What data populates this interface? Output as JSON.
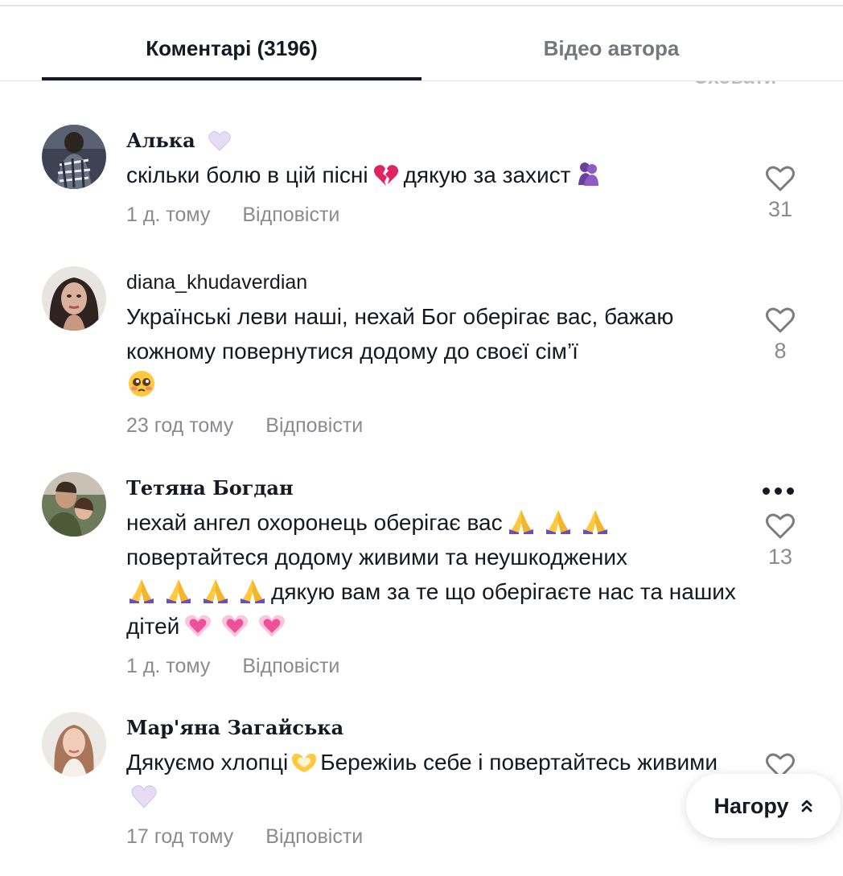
{
  "tabs": {
    "comments": "Коментарі (3196)",
    "author_videos": "Відео автора"
  },
  "hide_label": "Сховати",
  "comments": [
    {
      "username": "Алька",
      "text_parts": [
        "скільки болю в цій пісні",
        "дякую за захист"
      ],
      "time": "1 д. тому",
      "reply": "Відповісти",
      "likes": "31"
    },
    {
      "username": "diana_khudaverdian",
      "text": "Українські леви наші, нехай Бог оберігає вас, бажаю кожному повернутися додому до своєї сім’ї",
      "time": "23 год тому",
      "reply": "Відповісти",
      "likes": "8"
    },
    {
      "username": "Тетяна Богдан",
      "text_parts": [
        "нехай ангел охоронець оберігає вас",
        "повертайтеся додому живими та неушкоджених",
        "дякую вам за те що оберігаєте нас та наших дітей"
      ],
      "time": "1 д. тому",
      "reply": "Відповісти",
      "likes": "13"
    },
    {
      "username": "Мар'яна Загайська",
      "text_parts": [
        "Дякуємо хлопці",
        "Бережіиь себе і повертайтесь живими"
      ],
      "time": "17 год тому",
      "reply": "Відповісти"
    }
  ],
  "to_top_label": "Нагору",
  "colors": {
    "text": "#161823",
    "muted": "#8a8b91",
    "tab_inactive": "#75777f"
  }
}
